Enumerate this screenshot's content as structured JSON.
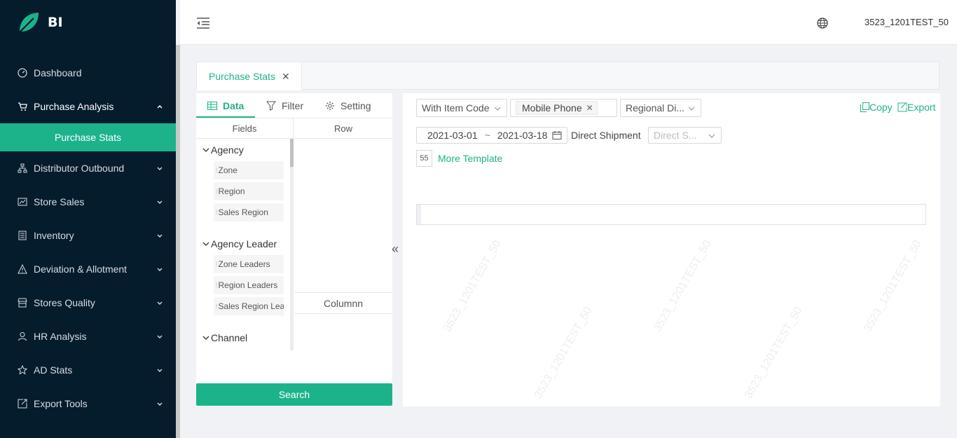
{
  "brand": {
    "name": "BI",
    "accent": "#1db38a",
    "sidebar_bg": "#051c2c"
  },
  "header": {
    "username": "3523_1201TEST_50",
    "menu_icon": "indent-icon",
    "lang_icon": "globe-icon"
  },
  "sidebar": {
    "items": [
      {
        "label": "Dashboard",
        "icon": "dashboard-icon"
      },
      {
        "label": "Purchase Analysis",
        "icon": "cart-icon",
        "open": true
      },
      {
        "label": "Purchase Stats",
        "sub": true,
        "active": true
      },
      {
        "label": "Distributor Outbound",
        "icon": "hierarchy-icon"
      },
      {
        "label": "Store Sales",
        "icon": "chart-icon"
      },
      {
        "label": "Inventory",
        "icon": "list-icon"
      },
      {
        "label": "Deviation & Allotment",
        "icon": "warning-icon"
      },
      {
        "label": "Stores Quality",
        "icon": "store-icon"
      },
      {
        "label": "HR Analysis",
        "icon": "user-icon"
      },
      {
        "label": "AD Stats",
        "icon": "star-icon"
      },
      {
        "label": "Export Tools",
        "icon": "export-icon"
      }
    ]
  },
  "tabs": [
    {
      "label": "Purchase Stats"
    }
  ],
  "left_panel": {
    "tabs": {
      "data": "Data",
      "filter": "Filter",
      "setting": "Setting"
    },
    "headers": {
      "fields": "Fields",
      "row": "Row",
      "column": "Columnn"
    },
    "groups": [
      {
        "title": "Agency",
        "fields": [
          "Zone",
          "Region",
          "Sales Region"
        ]
      },
      {
        "title": "Agency Leader",
        "fields": [
          "Zone Leaders",
          "Region Leaders",
          "Sales Region Leaders"
        ]
      },
      {
        "title": "Channel",
        "fields": []
      }
    ],
    "search": "Search"
  },
  "right_panel": {
    "item_code_select": "With Item Code",
    "category_tag": "Mobile Phone",
    "regional_select": "Regional Di...",
    "copy": "Copy",
    "export": "Export",
    "date_start": "2021-03-01",
    "date_sep": "~",
    "date_end": "2021-03-18",
    "direct_label": "Direct Shipment",
    "direct_placeholder": "Direct S...",
    "template_count": "55",
    "more_template": "More Template",
    "watermark": "3523_1201TEST_50"
  }
}
